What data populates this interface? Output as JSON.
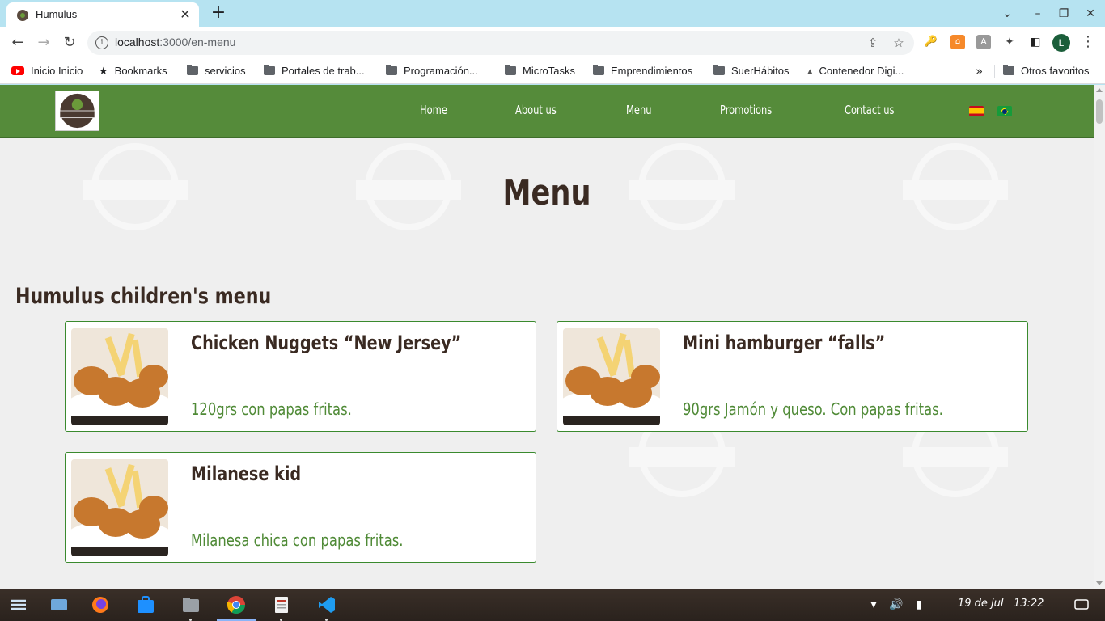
{
  "browser": {
    "tab_title": "Humulus",
    "url_host": "localhost",
    "url_rest": ":3000/en-menu",
    "profile_initial": "L"
  },
  "bookmarks": {
    "items": [
      {
        "label": "Inicio Inicio",
        "icon": "youtube-icon"
      },
      {
        "label": "Bookmarks",
        "icon": "star-icon"
      },
      {
        "label": "servicios",
        "icon": "folder-icon"
      },
      {
        "label": "Portales de trab...",
        "icon": "folder-icon"
      },
      {
        "label": "Programación...",
        "icon": "folder-icon"
      },
      {
        "label": "MicroTasks",
        "icon": "folder-icon"
      },
      {
        "label": "Emprendimientos",
        "icon": "folder-icon"
      },
      {
        "label": "SuerHábitos",
        "icon": "folder-icon"
      },
      {
        "label": "Contenedor Digi...",
        "icon": "drive-icon"
      }
    ],
    "other": "Otros favoritos"
  },
  "site": {
    "nav": [
      "Home",
      "About us",
      "Menu",
      "Promotions",
      "Contact us"
    ],
    "logo_text": "HUMULUS",
    "page_title": "Menu",
    "section_title": "Humulus children's menu",
    "items": [
      {
        "name": "Chicken Nuggets “New Jersey”",
        "desc": "120grs con papas fritas."
      },
      {
        "name": "Mini hamburger “falls”",
        "desc": "90grs Jamón y queso. Con papas fritas."
      },
      {
        "name": "Milanese kid",
        "desc": "Milanesa chica con papas fritas."
      }
    ],
    "colors": {
      "nav_green": "#558b3a",
      "title_brown": "#3a2a22",
      "desc_green": "#4f8a36",
      "card_border": "#3a8a2e"
    }
  },
  "taskbar": {
    "date": "19 de jul",
    "time": "13:22"
  }
}
